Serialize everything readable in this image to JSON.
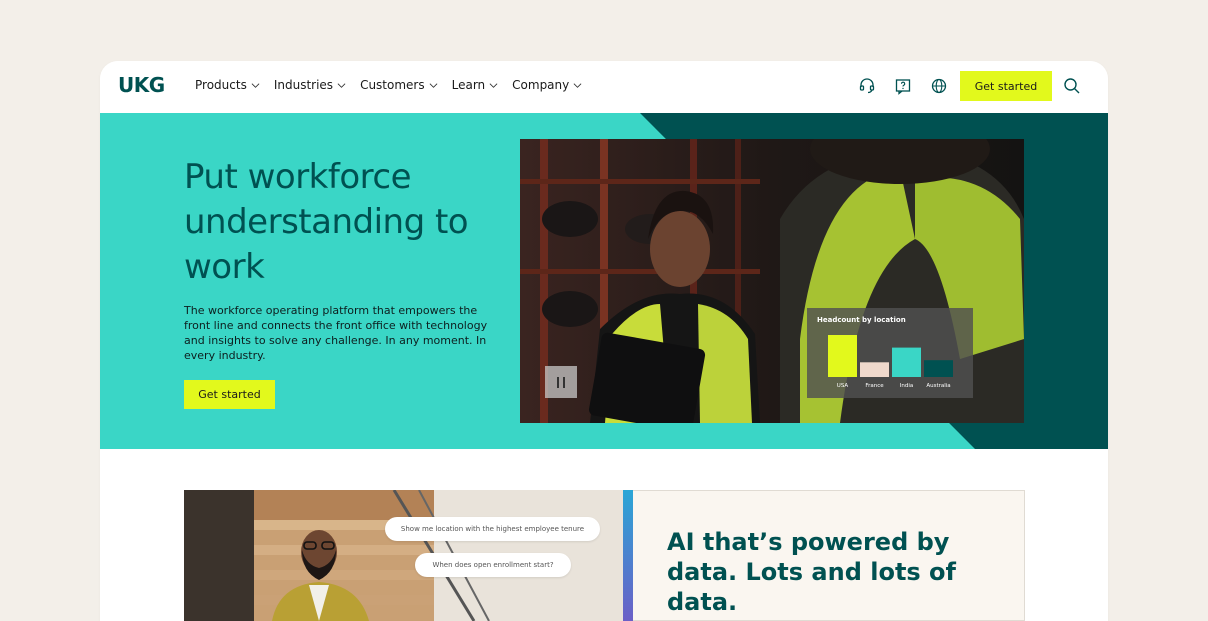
{
  "brand": {
    "logo": "UKG",
    "accent": "#e2f91c",
    "primary": "#005151",
    "hero_bg": "#3ad6c6"
  },
  "nav": {
    "items": [
      {
        "label": "Products"
      },
      {
        "label": "Industries"
      },
      {
        "label": "Customers"
      },
      {
        "label": "Learn"
      },
      {
        "label": "Company"
      }
    ],
    "icons": [
      "headset-icon",
      "help-icon",
      "globe-icon",
      "search-icon"
    ],
    "cta_label": "Get started"
  },
  "hero": {
    "title": "Put workforce understanding to work",
    "description": "The workforce operating platform that empowers the front line and connects the front office with technology and insights to solve any challenge. In any moment. In every industry.",
    "cta_label": "Get started",
    "chart_card": {
      "title": "Headcount by location",
      "bars": [
        {
          "label": "USA",
          "value": 100,
          "color": "#e2f91c"
        },
        {
          "label": "France",
          "value": 35,
          "color": "#f0d9cc"
        },
        {
          "label": "India",
          "value": 70,
          "color": "#3ad6c6"
        },
        {
          "label": "Australia",
          "value": 40,
          "color": "#005151"
        }
      ]
    }
  },
  "section2": {
    "bubbles": [
      "Show me location with the highest employee tenure",
      "When does open enrollment start?"
    ],
    "heading": "AI that’s powered by data. Lots and lots of data."
  }
}
